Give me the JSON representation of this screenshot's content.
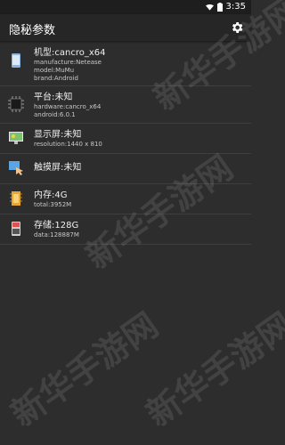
{
  "status": {
    "time": "3:35"
  },
  "appbar": {
    "title": "隐秘参数",
    "settings_icon": "gear-icon"
  },
  "items": [
    {
      "icon": "phone-icon",
      "main": "机型:cancro_x64",
      "subs": [
        "manufacture:Netease",
        "model:MuMu",
        "brand:Android"
      ]
    },
    {
      "icon": "chip-icon",
      "main": "平台:未知",
      "subs": [
        "hardware:cancro_x64",
        "android:6.0.1"
      ]
    },
    {
      "icon": "monitor-icon",
      "main": "显示屏:未知",
      "subs": [
        "resolution:1440 x 810"
      ]
    },
    {
      "icon": "touch-icon",
      "main": "触摸屏:未知",
      "subs": []
    },
    {
      "icon": "memory-icon",
      "main": "内存:4G",
      "subs": [
        "total:3952M"
      ]
    },
    {
      "icon": "storage-icon",
      "main": "存储:128G",
      "subs": [
        "data:128887M"
      ]
    }
  ],
  "watermark": "新华手游网"
}
